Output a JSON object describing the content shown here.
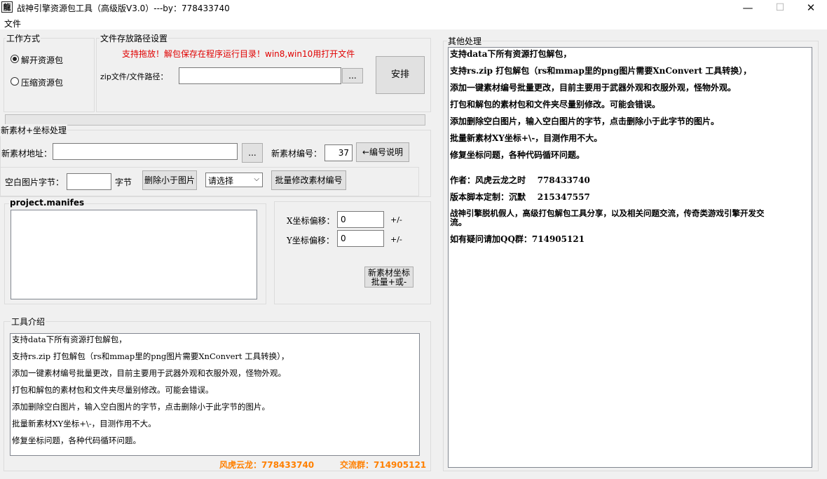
{
  "window": {
    "title": "战神引擎资源包工具（高级版V3.0）---by：778433740",
    "icon_text": "龍",
    "minimize_glyph": "—",
    "maximize_glyph": "☐",
    "close_glyph": "✕"
  },
  "menu": {
    "file": "文件"
  },
  "work_mode": {
    "title": "工作方式",
    "options": [
      "解开资源包",
      "压缩资源包"
    ],
    "selected": "解开资源包"
  },
  "file_path": {
    "title": "文件存放路径设置",
    "notice": "支持拖放！解包保存在程序运行目录！win8,win10用打开文件",
    "label": "zip文件/文件路径：",
    "value": "",
    "browse": "...",
    "action": "安排"
  },
  "progress": {
    "value_percent": 0
  },
  "material": {
    "title": "新素材+坐标处理",
    "address_label": "新素材地址：",
    "address_value": "",
    "browse": "...",
    "number_label": "新素材编号：",
    "number_value": "37",
    "number_help": "←编号说明",
    "blank_label": "空白图片字节：",
    "blank_value": "",
    "blank_unit": "字节",
    "delete_btn": "删除小于图片",
    "select_value": "请选择",
    "batch_btn": "批量修改素材编号"
  },
  "manifest": {
    "title": "project.manifes"
  },
  "coords": {
    "x_label": "X坐标偏移：",
    "x_value": "0",
    "x_hint": "+/-",
    "y_label": "Y坐标偏移：",
    "y_value": "0",
    "y_hint": "+/-",
    "batch_btn_line1": "新素材坐标",
    "batch_btn_line2": "批量+或-"
  },
  "tool_intro": {
    "title": "工具介绍",
    "lines": [
      "支持data下所有资源打包解包，",
      "支持rs.zip 打包解包（rs和mmap里的png图片需要XnConvert 工具转换），",
      "添加一键素材编号批量更改，目前主要用于武器外观和衣服外观，怪物外观。",
      "打包和解包的素材包和文件夹尽量别修改。可能会错误。",
      "添加删除空白图片，输入空白图片的字节，点击删除小于此字节的图片。",
      "批量新素材XY坐标+\\-，目测作用不大。",
      "修复坐标问题，各种代码循环问题。"
    ],
    "footer_left": "风虎云龙：778433740",
    "footer_right": "交流群：714905121"
  },
  "other": {
    "title": "其他处理",
    "lines": [
      "支持data下所有资源打包解包，",
      "支持rs.zip 打包解包（rs和mmap里的png图片需要XnConvert 工具转换），",
      "添加一键素材编号批量更改，目前主要用于武器外观和衣服外观，怪物外观。",
      "打包和解包的素材包和文件夹尽量别修改。可能会错误。",
      "添加删除空白图片，输入空白图片的字节，点击删除小于此字节的图片。",
      "批量新素材XY坐标+\\-，目测作用不大。",
      "修复坐标问题，各种代码循环问题。",
      "",
      "作者：风虎云龙之时    778433740",
      "版本脚本定制：沉默    215347557",
      "战神引擎脱机假人，高级打包解包工具分享，以及相关问题交流，传奇类游戏引擎开发交",
      "流。",
      "如有疑问请加QQ群：714905121"
    ]
  }
}
